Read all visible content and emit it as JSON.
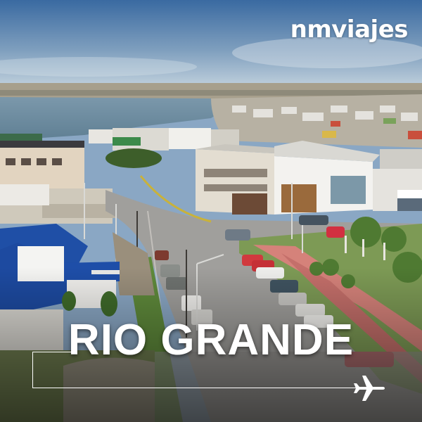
{
  "brand": {
    "logo_text": "nmviajes"
  },
  "title": "RIO GRANDE",
  "icons": {
    "plane": "airplane-icon"
  },
  "colors": {
    "sky_top": "#3f6fa3",
    "sky_bottom": "#c9d8e3",
    "water": "#6e8ea3",
    "roof_blue": "#1f4ea7",
    "road": "#9b9a98",
    "grass": "#5f8f3f",
    "text": "#ffffff"
  }
}
